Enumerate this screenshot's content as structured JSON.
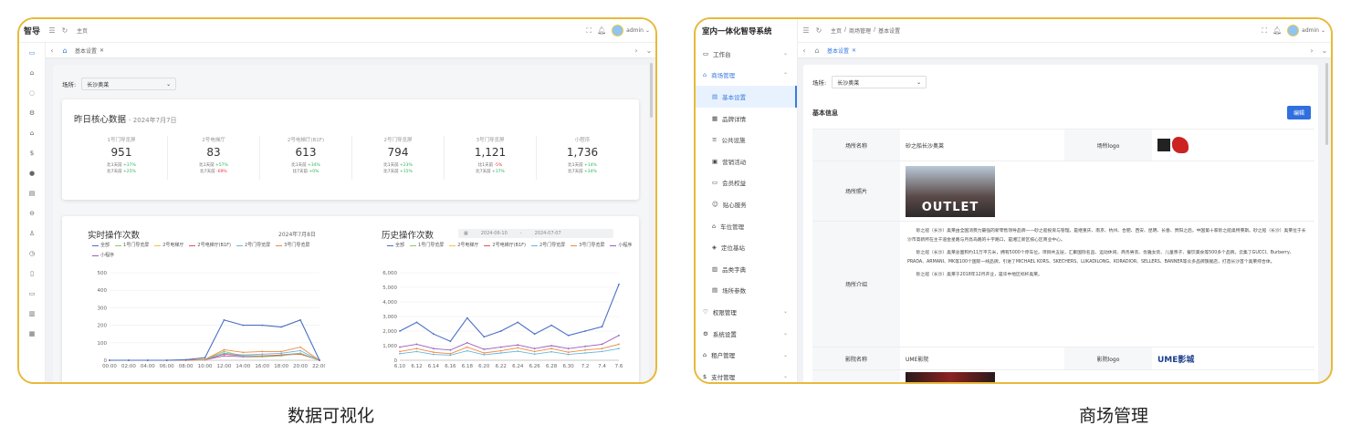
{
  "left": {
    "brand": "智导",
    "breadcrumb": "主页",
    "user": "admin",
    "tab": "基本设置",
    "venue_label": "场所:",
    "venue_value": "长沙奥莱",
    "core": {
      "title": "昨日核心数据",
      "date": "- 2024年7月7日",
      "metrics": [
        {
          "label": "1号门导览屏",
          "value": "951",
          "d1": "比1天前",
          "d1v": "+37%",
          "d1c": "up",
          "d7": "比7天前",
          "d7v": "+25%",
          "d7c": "up"
        },
        {
          "label": "2号电梯厅",
          "value": "83",
          "d1": "比1天前",
          "d1v": "+57%",
          "d1c": "up",
          "d7": "比7天前",
          "d7v": "-69%",
          "d7c": "dn"
        },
        {
          "label": "2号电梯厅(B1F)",
          "value": "613",
          "d1": "比1天前",
          "d1v": "+34%",
          "d1c": "up",
          "d7": "比7天前",
          "d7v": "+0%",
          "d7c": "up"
        },
        {
          "label": "2号门导览屏",
          "value": "794",
          "d1": "比1天前",
          "d1v": "+23%",
          "d1c": "up",
          "d7": "比7天前",
          "d7v": "+15%",
          "d7c": "up"
        },
        {
          "label": "3号门导览屏",
          "value": "1,121",
          "d1": "比1天前",
          "d1v": "-5%",
          "d1c": "dn",
          "d7": "比7天前",
          "d7v": "+17%",
          "d7c": "up"
        },
        {
          "label": "小程序",
          "value": "1,736",
          "d1": "比1天前",
          "d1v": "+14%",
          "d1c": "up",
          "d7": "比7天前",
          "d7v": "+34%",
          "d7c": "up"
        }
      ]
    },
    "realtime": {
      "title": "实时操作次数",
      "date": "2024年7月8日"
    },
    "history": {
      "title": "历史操作次数",
      "date_from": "2024-06-10",
      "date_sep": "-",
      "date_to": "2024-07-07"
    },
    "legend": [
      "全部",
      "1号门导览屏",
      "2号电梯厅",
      "2号电梯厅(B1F)",
      "2号门导览屏",
      "3号门导览屏",
      "小程序"
    ],
    "legend_colors": [
      "#4a6fc4",
      "#8fcb6b",
      "#f4c23c",
      "#e05555",
      "#6bb6e0",
      "#f08a3c",
      "#9b5fc0"
    ]
  },
  "chart_data": [
    {
      "type": "line",
      "title": "实时操作次数",
      "x": [
        "00:00",
        "02:00",
        "04:00",
        "06:00",
        "08:00",
        "10:00",
        "12:00",
        "14:00",
        "16:00",
        "18:00",
        "20:00",
        "22:00"
      ],
      "ylim": [
        0,
        500
      ],
      "yticks": [
        0,
        100,
        200,
        300,
        400,
        500
      ],
      "series": [
        {
          "name": "全部",
          "values": [
            0,
            0,
            0,
            0,
            3,
            15,
            230,
            200,
            200,
            190,
            230,
            0
          ]
        },
        {
          "name": "3号门导览屏",
          "values": [
            0,
            0,
            0,
            0,
            1,
            5,
            60,
            45,
            50,
            50,
            75,
            0
          ]
        },
        {
          "name": "2号门导览屏",
          "values": [
            0,
            0,
            0,
            0,
            1,
            4,
            40,
            30,
            35,
            40,
            55,
            0
          ]
        },
        {
          "name": "1号门导览屏",
          "values": [
            0,
            0,
            0,
            0,
            1,
            4,
            50,
            25,
            20,
            25,
            40,
            0
          ]
        },
        {
          "name": "2号电梯厅(B1F)",
          "values": [
            0,
            0,
            0,
            0,
            0,
            3,
            35,
            25,
            25,
            30,
            35,
            0
          ]
        },
        {
          "name": "小程序",
          "values": [
            0,
            0,
            0,
            0,
            1,
            3,
            25,
            20,
            20,
            30,
            40,
            0
          ]
        }
      ]
    },
    {
      "type": "line",
      "title": "历史操作次数",
      "x": [
        "6.10",
        "6.12",
        "6.14",
        "6.16",
        "6.18",
        "6.20",
        "6.22",
        "6.24",
        "6.26",
        "6.28",
        "6.30",
        "7.2",
        "7.4",
        "7.6"
      ],
      "ylim": [
        0,
        6000
      ],
      "yticks": [
        "0",
        "1,000",
        "2,000",
        "3,000",
        "4,000",
        "5,000",
        "6,000"
      ],
      "series": [
        {
          "name": "全部",
          "values": [
            2000,
            2600,
            1800,
            1300,
            2900,
            1600,
            2000,
            2600,
            1800,
            2400,
            1700,
            2000,
            2300,
            5200
          ]
        },
        {
          "name": "小程序",
          "values": [
            900,
            1100,
            800,
            700,
            1200,
            750,
            900,
            1050,
            800,
            1000,
            800,
            950,
            1100,
            1700
          ]
        },
        {
          "name": "3号门导览屏",
          "values": [
            600,
            800,
            550,
            450,
            900,
            500,
            650,
            850,
            600,
            800,
            550,
            700,
            800,
            1100
          ]
        },
        {
          "name": "2号门导览屏",
          "values": [
            450,
            600,
            400,
            350,
            650,
            380,
            500,
            620,
            420,
            580,
            400,
            500,
            600,
            800
          ]
        }
      ]
    }
  ],
  "right": {
    "brand": "室内一体化智导系统",
    "breadcrumb": [
      "主页",
      "/",
      "商场管理",
      "/",
      "基本设置"
    ],
    "user": "admin",
    "tab": "基本设置",
    "menu": [
      {
        "label": "工作台",
        "sub": false,
        "chev": "⌄",
        "icon": "▭"
      },
      {
        "label": "商场管理",
        "sub": false,
        "chev": "⌃",
        "icon": "⌂",
        "on_parent": true
      },
      {
        "label": "基本设置",
        "sub": true,
        "icon": "▤",
        "on": true
      },
      {
        "label": "品牌详情",
        "sub": true,
        "icon": "▦"
      },
      {
        "label": "公共设施",
        "sub": true,
        "icon": "≡"
      },
      {
        "label": "营销活动",
        "sub": true,
        "icon": "▣"
      },
      {
        "label": "会员权益",
        "sub": true,
        "icon": "▭"
      },
      {
        "label": "贴心服务",
        "sub": true,
        "icon": "☺"
      },
      {
        "label": "车位管理",
        "sub": true,
        "icon": "⌂"
      },
      {
        "label": "定位基站",
        "sub": true,
        "icon": "◈"
      },
      {
        "label": "品类字典",
        "sub": true,
        "icon": "▥"
      },
      {
        "label": "场所参数",
        "sub": true,
        "icon": "▤"
      },
      {
        "label": "权限管理",
        "sub": false,
        "chev": "⌄",
        "icon": "♡"
      },
      {
        "label": "系统设置",
        "sub": false,
        "chev": "⌄",
        "icon": "⚙"
      },
      {
        "label": "租户管理",
        "sub": false,
        "chev": "⌄",
        "icon": "⌂"
      },
      {
        "label": "支付管理",
        "sub": false,
        "chev": "⌄",
        "icon": "$"
      }
    ],
    "venue_label": "场所:",
    "venue_value": "长沙奥莱",
    "section_title": "基本信息",
    "edit": "编辑",
    "fields": {
      "name_label": "场所名称",
      "name_value": "砂之船长沙奥莱",
      "logo_label": "场所logo",
      "photo_label": "场所照片",
      "photo_text": "OUTLET",
      "intro_label": "场所介绍",
      "intro_p1": "砂之船（长沙）奥莱由全国消费力最强的新零售领导品牌——砂之船投资与管理，是继重庆、南京、杭州、合肥、西安、昆明、长春、贵阳之后，中国第十家砂之船奥特莱斯。砂之船（长沙）奥莱位于长沙市高新所在主干道金星路与月亮岛路的十字路口，是湘江新区核心区商业中心。",
      "intro_p2": "砂之船（长沙）奥莱总面积约11万平方米，拥有5000个停车位。项目共五层，汇聚国际名品、运动休闲、商务男装、优雅女装、儿童亲子、餐饮美食等500多个品牌。云集了GUCCI、Burberry、PRADA、ARMANI、MK等100个国际一线品牌，引进了MICHAEL KORS、SKECHERS、LUKADILONG、KORADIOR、SELLERS、BANNER等众多品牌旗舰店，打造长沙首个奥莱综合体。",
      "intro_p3": "砂之船（长沙）奥莱于2018年12月开业，是华中地区标杆奥莱。",
      "cinema_label": "影院名称",
      "cinema_value": "UME影院",
      "cinema_logo_label": "影院logo",
      "cinema_logo_text": "UME影城"
    }
  },
  "captions": {
    "left": "数据可视化",
    "right": "商场管理"
  }
}
